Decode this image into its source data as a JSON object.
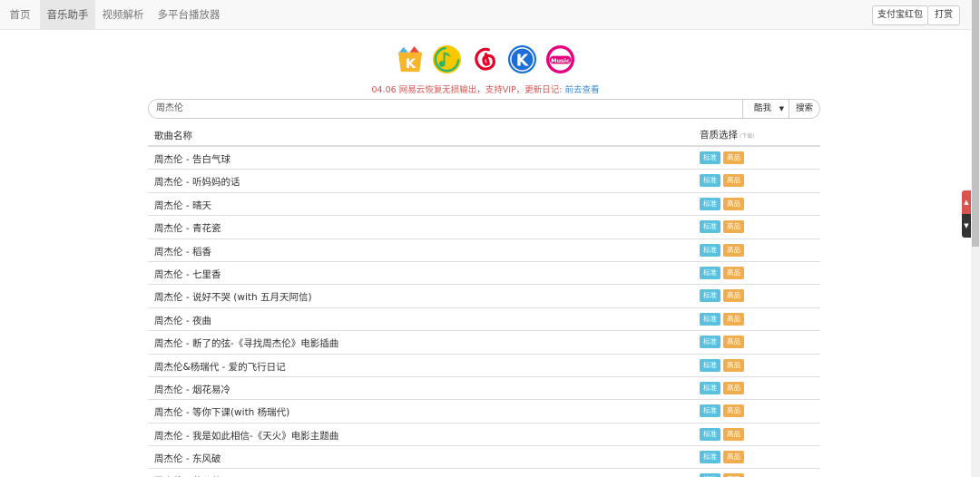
{
  "nav": {
    "items": [
      {
        "label": "首页",
        "active": false
      },
      {
        "label": "音乐助手",
        "active": true
      },
      {
        "label": "视频解析",
        "active": false
      },
      {
        "label": "多平台播放器",
        "active": false
      }
    ],
    "alipay_label": "支付宝红包",
    "donate_label": "打赏"
  },
  "platforms": [
    {
      "name": "kuwo-logo-icon",
      "color": "#f7b52c"
    },
    {
      "name": "qq-music-logo-icon",
      "color": "#f6c800"
    },
    {
      "name": "netease-music-logo-icon",
      "color": "#e60026"
    },
    {
      "name": "kugou-logo-icon",
      "color": "#1c6ed6"
    },
    {
      "name": "migu-music-logo-icon",
      "color": "#e6007e"
    }
  ],
  "notice": {
    "text": "04.06 网易云恢复无损输出，支持VIP，更新日记: ",
    "link": "前去查看"
  },
  "search": {
    "value": "周杰伦",
    "source": "酷我",
    "button": "搜索"
  },
  "table": {
    "col_name": "歌曲名称",
    "col_quality": "音质选择",
    "col_quality_hint": "(下载)",
    "std_label": "标准",
    "hq_label": "高品",
    "rows": [
      "周杰伦 - 告白气球",
      "周杰伦 - 听妈妈的话",
      "周杰伦 - 晴天",
      "周杰伦 - 青花瓷",
      "周杰伦 - 稻香",
      "周杰伦 - 七里香",
      "周杰伦 - 说好不哭 (with 五月天阿信)",
      "周杰伦 - 夜曲",
      "周杰伦 - 断了的弦-《寻找周杰伦》电影插曲",
      "周杰伦&杨瑞代 - 爱的飞行日记",
      "周杰伦 - 烟花易冷",
      "周杰伦 - 等你下课(with 杨瑞代)",
      "周杰伦 - 我是如此相信-《天火》电影主题曲",
      "周杰伦 - 东风破",
      "周杰伦 - 蒲公英"
    ]
  },
  "colors": {
    "std": "#5bc0de",
    "hq": "#f0ad4e",
    "notice": "#d9534f",
    "link": "#428bca"
  }
}
